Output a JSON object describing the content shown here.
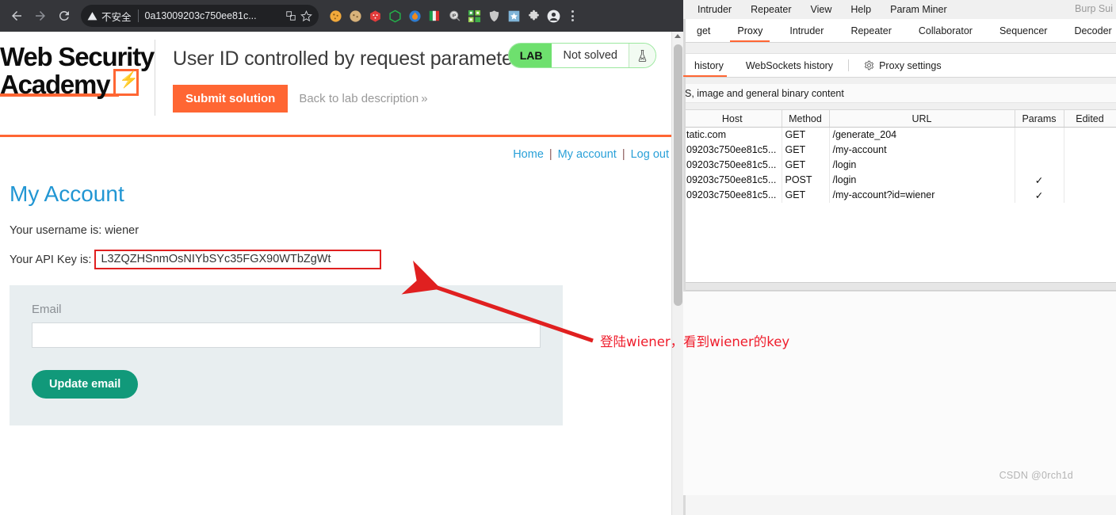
{
  "browser": {
    "nav": {
      "back_label": "Back",
      "forward_label": "Forward",
      "reload_label": "Reload"
    },
    "omnibox": {
      "security_label": "不安全",
      "url": "0a13009203c750ee81c...",
      "translate_icon": "translate-icon",
      "bookmark_icon": "star-icon"
    },
    "extensions": [
      {
        "name": "extension-cookie-orange",
        "glyph": "🍪"
      },
      {
        "name": "extension-cookie-tan",
        "glyph": "🍪"
      },
      {
        "name": "extension-red-cube",
        "glyph": "🎲"
      },
      {
        "name": "extension-green-hex",
        "glyph": "⬡"
      },
      {
        "name": "extension-blue-flame",
        "glyph": "🔥"
      },
      {
        "name": "extension-italy-flag",
        "glyph": "🇮🇹"
      },
      {
        "name": "extension-ip-lookup",
        "glyph": "IP"
      },
      {
        "name": "extension-qr-code",
        "glyph": "▦"
      },
      {
        "name": "extension-grey-shield",
        "glyph": "🛡"
      },
      {
        "name": "extension-blue-star",
        "glyph": "★"
      },
      {
        "name": "extension-puzzle-piece",
        "glyph": "🧩"
      },
      {
        "name": "profile-avatar",
        "glyph": "👤"
      }
    ],
    "menu_label": "Chrome menu"
  },
  "lab": {
    "logo_line1": "Web Security",
    "logo_line2": "Academy",
    "title": "User ID controlled by request parameter",
    "submit_label": "Submit solution",
    "back_label": "Back to lab description",
    "back_chevron": "»",
    "status": {
      "tag": "LAB",
      "state": "Not solved",
      "flask_icon": "flask-icon"
    },
    "accent_color": "#ff6633",
    "status_color": "#6ee06e"
  },
  "site": {
    "nav": [
      {
        "label": "Home",
        "name": "nav-home"
      },
      {
        "label": "My account",
        "name": "nav-my-account"
      },
      {
        "label": "Log out",
        "name": "nav-log-out"
      }
    ],
    "nav_separator": "|",
    "heading": "My Account",
    "username_line": "Your username is: wiener",
    "apikey_label": "Your API Key is:",
    "apikey_value": "L3ZQZHSnmOsNIYbSYc35FGX90WTbZgWt",
    "apikey_highlight_color": "#e02020",
    "form": {
      "email_label": "Email",
      "email_value": "",
      "email_placeholder": "",
      "update_label": "Update email",
      "button_color": "#11997a"
    }
  },
  "annotation": {
    "text": "登陆wiener，看到wiener的key",
    "color": "#ef1c2b"
  },
  "burp": {
    "window_title": "Burp Sui",
    "menu": [
      "Intruder",
      "Repeater",
      "View",
      "Help",
      "Param Miner"
    ],
    "tabs": [
      {
        "label": "get",
        "active": false
      },
      {
        "label": "Proxy",
        "active": true
      },
      {
        "label": "Intruder",
        "active": false
      },
      {
        "label": "Repeater",
        "active": false
      },
      {
        "label": "Collaborator",
        "active": false
      },
      {
        "label": "Sequencer",
        "active": false
      },
      {
        "label": "Decoder",
        "active": false
      }
    ],
    "sub_tabs": [
      {
        "label": "history",
        "active": true
      },
      {
        "label": "WebSockets history",
        "active": false
      }
    ],
    "proxy_settings_label": "Proxy settings",
    "proxy_settings_icon": "gear-icon",
    "filter_text": "S, image and general binary content",
    "table": {
      "columns": [
        "Host",
        "Method",
        "URL",
        "Params",
        "Edited"
      ],
      "rows": [
        {
          "host": "tatic.com",
          "method": "GET",
          "url": "/generate_204",
          "params": "",
          "edited": ""
        },
        {
          "host": "09203c750ee81c5...",
          "method": "GET",
          "url": "/my-account",
          "params": "",
          "edited": ""
        },
        {
          "host": "09203c750ee81c5...",
          "method": "GET",
          "url": "/login",
          "params": "",
          "edited": ""
        },
        {
          "host": "09203c750ee81c5...",
          "method": "POST",
          "url": "/login",
          "params": "✓",
          "edited": ""
        },
        {
          "host": "09203c750ee81c5...",
          "method": "GET",
          "url": "/my-account?id=wiener",
          "params": "✓",
          "edited": ""
        }
      ]
    }
  },
  "watermark": "CSDN @0rch1d"
}
